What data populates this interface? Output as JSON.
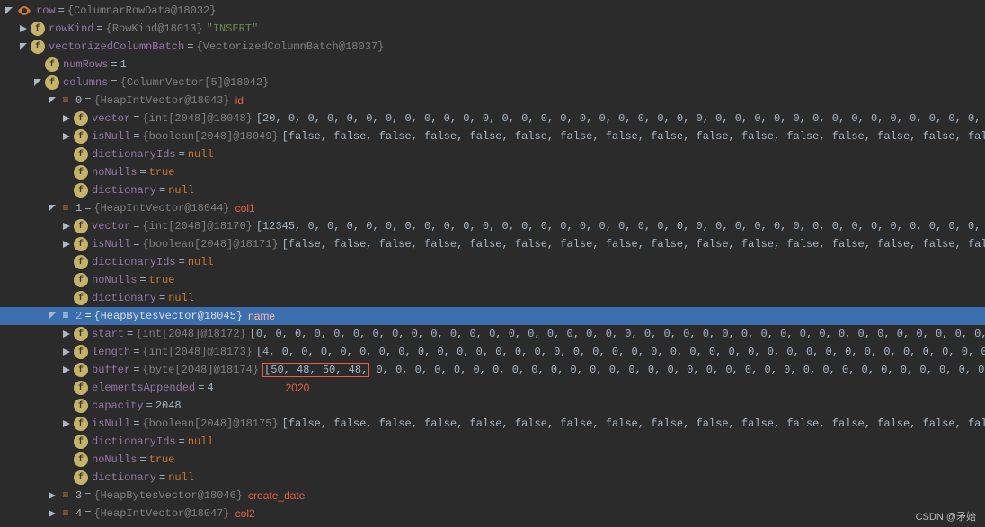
{
  "root": {
    "name": "row",
    "type": "{ColumnarRowData@18032}"
  },
  "rowKind": {
    "name": "rowKind",
    "type": "{RowKind@18013}",
    "value": "\"INSERT\""
  },
  "vcb": {
    "name": "vectorizedColumnBatch",
    "type": "{VectorizedColumnBatch@18037}"
  },
  "numRows": {
    "name": "numRows",
    "value": "1"
  },
  "columns": {
    "name": "columns",
    "type": "{ColumnVector[5]@18042}"
  },
  "c0": {
    "idx": "0",
    "type": "{HeapIntVector@18043}",
    "annot": "id"
  },
  "c0_vector": {
    "name": "vector",
    "type": "{int[2048]@18048}",
    "value": "[20, 0, 0, 0, 0, 0, 0, 0, 0, 0, 0, 0, 0, 0, 0, 0, 0, 0, 0, 0, 0, 0, 0, 0, 0, 0, 0, 0, 0, 0, 0, 0, 0, 0, 0, 0, 0, 0, 0, 0, 0, 0, 0, 0, 0, 0, 0, 0, 0, 0, 0, 0, 0, 0, 0, 0, 0, 0, 0, 0, 0, 0, 0, 0, 0, 0, 0, 0, 0"
  },
  "c0_isnull": {
    "name": "isNull",
    "type": "{boolean[2048]@18049}",
    "value": "[false, false, false, false, false, false, false, false, false, false, false, false, false, false, false, false, false, false, false, false, false, fa"
  },
  "c0_dictIds": {
    "name": "dictionaryIds",
    "value": "null"
  },
  "c0_nonulls": {
    "name": "noNulls",
    "value": "true"
  },
  "c0_dict": {
    "name": "dictionary",
    "value": "null"
  },
  "c1": {
    "idx": "1",
    "type": "{HeapIntVector@18044}",
    "annot": "col1"
  },
  "c1_vector": {
    "name": "vector",
    "type": "{int[2048]@18170}",
    "value": "[12345, 0, 0, 0, 0, 0, 0, 0, 0, 0, 0, 0, 0, 0, 0, 0, 0, 0, 0, 0, 0, 0, 0, 0, 0, 0, 0, 0, 0, 0, 0, 0, 0, 0, 0, 0, 0, 0, 0, 0, 0, 0, 0, 0, 0, 0, 0, 0, 0, 0, 0, 0, 0, 0, 0, 0, 0, 0, 0, 0, 0, 0, 0, 0, 0, 0, 0, 0,"
  },
  "c1_isnull": {
    "name": "isNull",
    "type": "{boolean[2048]@18171}",
    "value": "[false, false, false, false, false, false, false, false, false, false, false, false, false, false, false, false, false, false, false, false, false, fals"
  },
  "c1_dictIds": {
    "name": "dictionaryIds",
    "value": "null"
  },
  "c1_nonulls": {
    "name": "noNulls",
    "value": "true"
  },
  "c1_dict": {
    "name": "dictionary",
    "value": "null"
  },
  "c2": {
    "idx": "2",
    "type": "{HeapBytesVector@18045}",
    "annot": "name"
  },
  "c2_start": {
    "name": "start",
    "type": "{int[2048]@18172}",
    "value": "[0, 0, 0, 0, 0, 0, 0, 0, 0, 0, 0, 0, 0, 0, 0, 0, 0, 0, 0, 0, 0, 0, 0, 0, 0, 0, 0, 0, 0, 0, 0, 0, 0, 0, 0, 0, 0, 0, 0, 0, 0, 0, 0, 0, 0, 0, 0, 0, 0, 0, 0, 0, 0, 0, 0, 0, 0, 0, 0, 0, 0, 0, 0, 0, 0, 0, 0, 0, 0,"
  },
  "c2_length": {
    "name": "length",
    "type": "{int[2048]@18173}",
    "value": "[4, 0, 0, 0, 0, 0, 0, 0, 0, 0, 0, 0, 0, 0, 0, 0, 0, 0, 0, 0, 0, 0, 0, 0, 0, 0, 0, 0, 0, 0, 0, 0, 0, 0, 0, 0, 0, 0, 0, 0, 0, 0, 0, 0, 0, 0, 0, 0, 0, 0, 0, 0, 0, 0, 0, 0, 0, 0, 0, 0, 0, 0, 0, 0, 0, 0, 0, 0,"
  },
  "c2_buffer": {
    "name": "buffer",
    "type": "{byte[2048]@18174}",
    "boxed": "[50, 48, 50, 48,",
    "rest": " 0, 0, 0, 0, 0, 0, 0, 0, 0, 0, 0, 0, 0, 0, 0, 0, 0, 0, 0, 0, 0, 0, 0, 0, 0, 0, 0, 0, 0, 0, 0, 0, 0, 0, 0, 0, 0, 0, 0, 0, 0, 0, 0, 0, 0, 0, 0, 0, 0, 0, 0, 0, 0, 0, 0, 0, 0, 0, 0, 0, 0,",
    "annot": "2020"
  },
  "c2_elemApp": {
    "name": "elementsAppended",
    "value": "4"
  },
  "c2_capacity": {
    "name": "capacity",
    "value": "2048"
  },
  "c2_isnull": {
    "name": "isNull",
    "type": "{boolean[2048]@18175}",
    "value": "[false, false, false, false, false, false, false, false, false, false, false, false, false, false, false, false, false, false, false, false, false, fal"
  },
  "c2_dictIds": {
    "name": "dictionaryIds",
    "value": "null"
  },
  "c2_nonulls": {
    "name": "noNulls",
    "value": "true"
  },
  "c2_dict": {
    "name": "dictionary",
    "value": "null"
  },
  "c3": {
    "idx": "3",
    "type": "{HeapBytesVector@18046}",
    "annot": "create_date"
  },
  "c4": {
    "idx": "4",
    "type": "{HeapIntVector@18047}",
    "annot": "col2"
  },
  "watermark": "CSDN @矛始"
}
